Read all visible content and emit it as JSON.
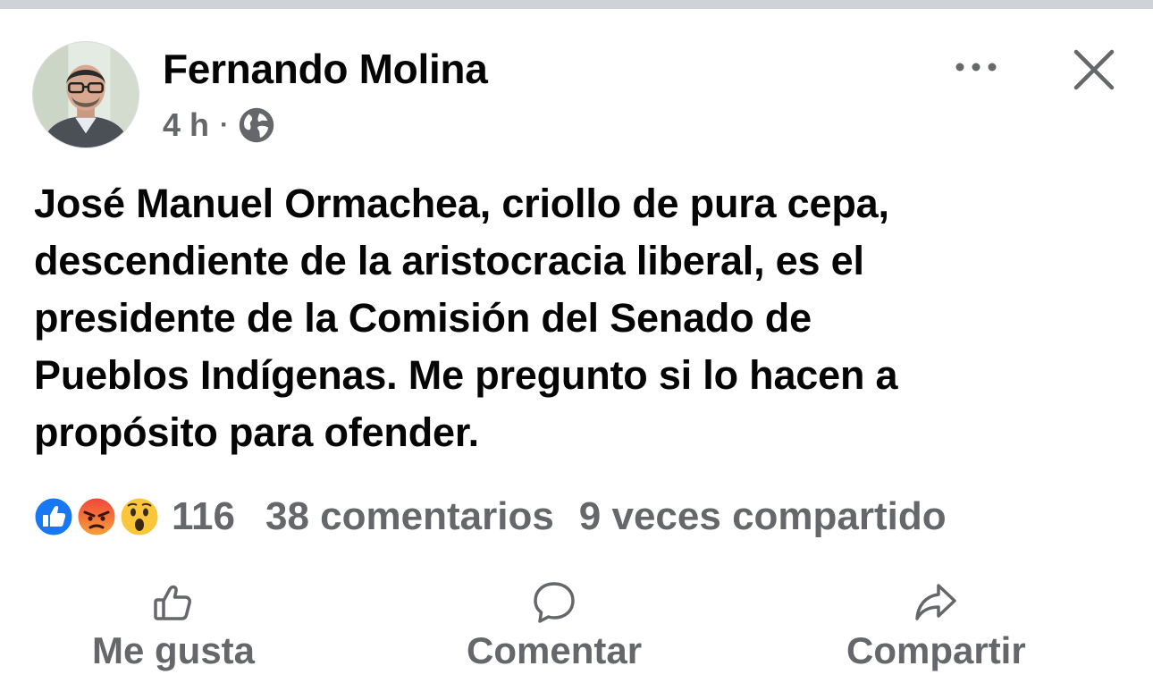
{
  "post": {
    "author": "Fernando Molina",
    "time": "4 h",
    "separator": "·",
    "privacy_icon": "globe-icon",
    "text_lines": [
      "José Manuel Ormachea, criollo de pura cepa,",
      "descendiente de la aristocracia liberal, es el",
      "presidente de la Comisión del Senado de",
      "Pueblos Indígenas. Me pregunto si lo hacen a",
      "propósito para ofender."
    ]
  },
  "header_actions": {
    "more_icon": "more-options-icon",
    "close_icon": "close-icon"
  },
  "stats": {
    "reactions": [
      "like-reaction-icon",
      "angry-reaction-icon",
      "wow-reaction-icon"
    ],
    "reaction_count": "116",
    "comments": "38 comentarios",
    "shares": "9 veces compartido"
  },
  "actions": {
    "like": {
      "label": "Me gusta",
      "icon": "thumbs-up-icon"
    },
    "comment": {
      "label": "Comentar",
      "icon": "comment-bubble-icon"
    },
    "share": {
      "label": "Compartir",
      "icon": "share-arrow-icon"
    }
  },
  "colors": {
    "text": "#050505",
    "secondary_text": "#65676b",
    "like_blue": "#1877f2",
    "angry_red": "#f0453a",
    "wow_yellow": "#fcc63b",
    "top_bar": "#cfd2d6"
  }
}
